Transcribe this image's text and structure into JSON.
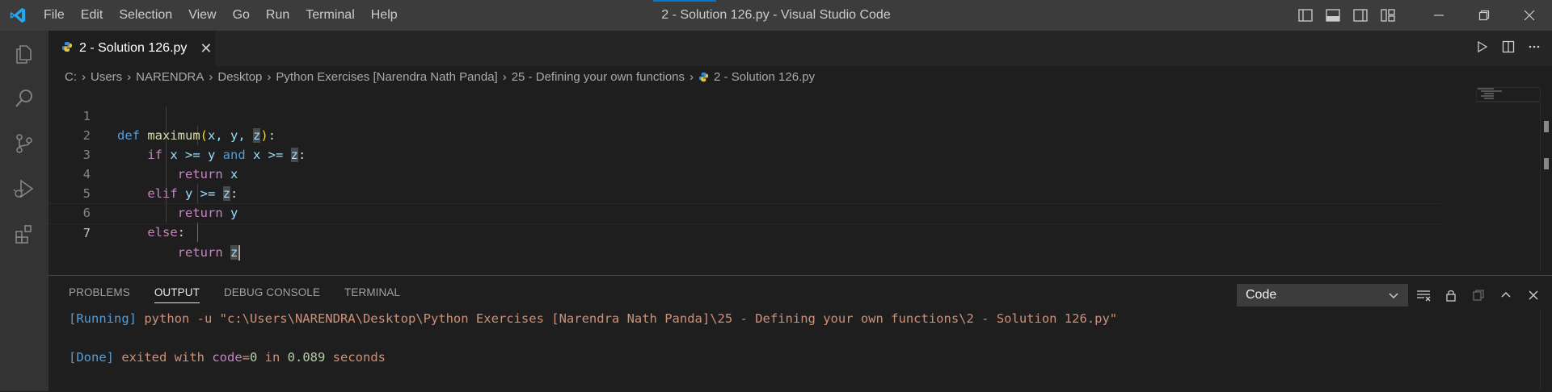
{
  "window": {
    "title": "2 - Solution 126.py - Visual Studio Code",
    "menu": [
      "File",
      "Edit",
      "Selection",
      "View",
      "Go",
      "Run",
      "Terminal",
      "Help"
    ]
  },
  "tab": {
    "label": "2 - Solution 126.py",
    "close": "✕"
  },
  "breadcrumb": {
    "items": [
      "C:",
      "Users",
      "NARENDRA",
      "Desktop",
      "Python Exercises [Narendra Nath Panda]",
      "25 - Defining your own functions"
    ],
    "file": "2 - Solution 126.py",
    "separator": "›"
  },
  "code": {
    "line_numbers": [
      "1",
      "2",
      "3",
      "4",
      "5",
      "6",
      "7"
    ],
    "l1": {
      "def": "def",
      "name": "maximum",
      "open": "(",
      "params": "x, y, ",
      "z": "z",
      "close": ")",
      "colon": ":"
    },
    "l2": {
      "indent": "    ",
      "if": "if",
      "a": " x >= y ",
      "and": "and",
      "b": " x >= ",
      "z": "z",
      "colon": ":"
    },
    "l3": {
      "indent": "        ",
      "ret": "return",
      "val": " x"
    },
    "l4": {
      "indent": "    ",
      "elif": "elif",
      "a": " y >= ",
      "z": "z",
      "colon": ":"
    },
    "l5": {
      "indent": "        ",
      "ret": "return",
      "val": " y"
    },
    "l6": {
      "indent": "    ",
      "else": "else",
      "colon": ":"
    },
    "l7": {
      "indent": "        ",
      "ret": "return",
      "space": " ",
      "z": "z"
    }
  },
  "panel": {
    "tabs": [
      "PROBLEMS",
      "OUTPUT",
      "DEBUG CONSOLE",
      "TERMINAL"
    ],
    "active_tab": "OUTPUT",
    "output_channel": "Code",
    "running": {
      "tag": "[Running]",
      "cmd": " python -u \"c:\\Users\\NARENDRA\\Desktop\\Python Exercises [Narendra Nath Panda]\\25 - Defining your own functions\\2 - Solution 126.py\""
    },
    "done": {
      "tag": "[Done]",
      "t1": " exited with ",
      "code": "code",
      "eq": "=",
      "zero": "0",
      "in": " in ",
      "secs": "0.089",
      "t2": " seconds"
    }
  },
  "colors": {
    "accent": "#007acc",
    "keyword_blue": "#569cd6",
    "keyword_purple": "#c586c0",
    "function_yellow": "#dcdcaa",
    "string_orange": "#ce9178",
    "number_green": "#b5cea8"
  }
}
